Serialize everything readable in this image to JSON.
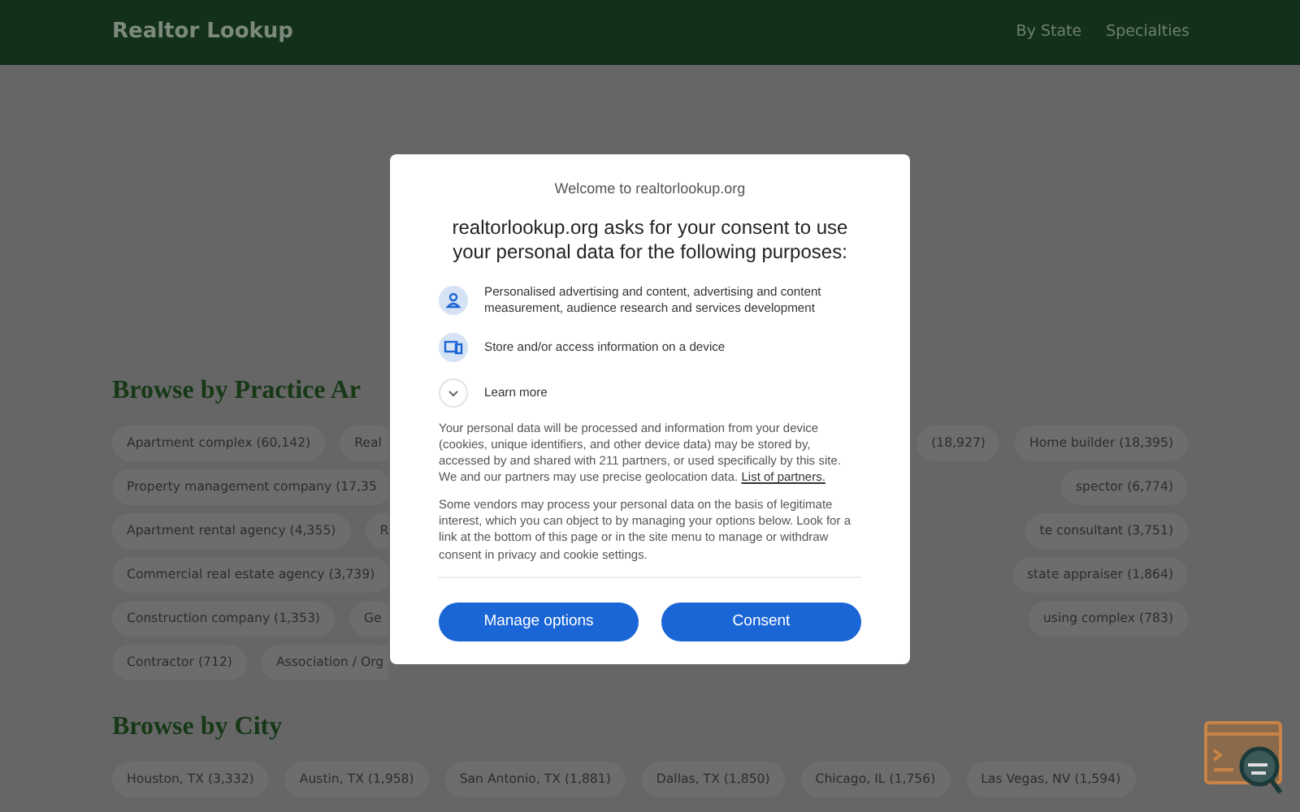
{
  "header": {
    "logo": "Realtor Lookup",
    "nav": [
      "By State",
      "Specialties"
    ]
  },
  "practice_section": {
    "heading": "Browse by Practice Ar",
    "rows": [
      {
        "left": [
          "Apartment complex (60,142)",
          "Real"
        ],
        "right": [
          "(18,927)",
          "Home builder (18,395)"
        ]
      },
      {
        "left": [
          "Property management company (17,35"
        ],
        "right": [
          "spector (6,774)"
        ]
      },
      {
        "left": [
          "Apartment rental agency (4,355)",
          "R"
        ],
        "right": [
          "te consultant (3,751)"
        ]
      },
      {
        "left": [
          "Commercial real estate agency (3,739)"
        ],
        "right": [
          "state appraiser (1,864)"
        ]
      },
      {
        "left": [
          "Construction company (1,353)",
          "Ge"
        ],
        "right": [
          "using complex (783)"
        ]
      },
      {
        "left": [
          "Contractor (712)",
          "Association / Org"
        ],
        "right": []
      }
    ]
  },
  "city_section": {
    "heading": "Browse by City",
    "rows": [
      [
        "Houston, TX (3,332)",
        "Austin, TX (1,958)",
        "San Antonio, TX (1,881)",
        "Dallas, TX (1,850)",
        "Chicago, IL (1,756)",
        "Las Vegas, NV (1,594)"
      ]
    ]
  },
  "consent": {
    "welcome": "Welcome to realtorlookup.org",
    "heading": "realtorlookup.org asks for your consent to use your personal data for the following purposes:",
    "purposes": [
      {
        "kind": "person",
        "text": "Personalised advertising and content, advertising and content measurement, audience research and services development"
      },
      {
        "kind": "device",
        "text": "Store and/or access information on a device"
      }
    ],
    "learn_more": "Learn more",
    "paragraphs": [
      {
        "text": "Your personal data will be processed and information from your device (cookies, unique identifiers, and other device data) may be stored by, accessed by and shared with 211 partners, or used specifically by this site. We and our partners may use precise geolocation data.",
        "link": "List of partners."
      },
      {
        "text": "Some vendors may process your personal data on the basis of legitimate interest, which you can object to by managing your options below. Look for a link at the bottom of this page or in the site menu to manage or withdraw consent in privacy and cookie settings."
      }
    ],
    "buttons": [
      "Manage options",
      "Consent"
    ]
  }
}
